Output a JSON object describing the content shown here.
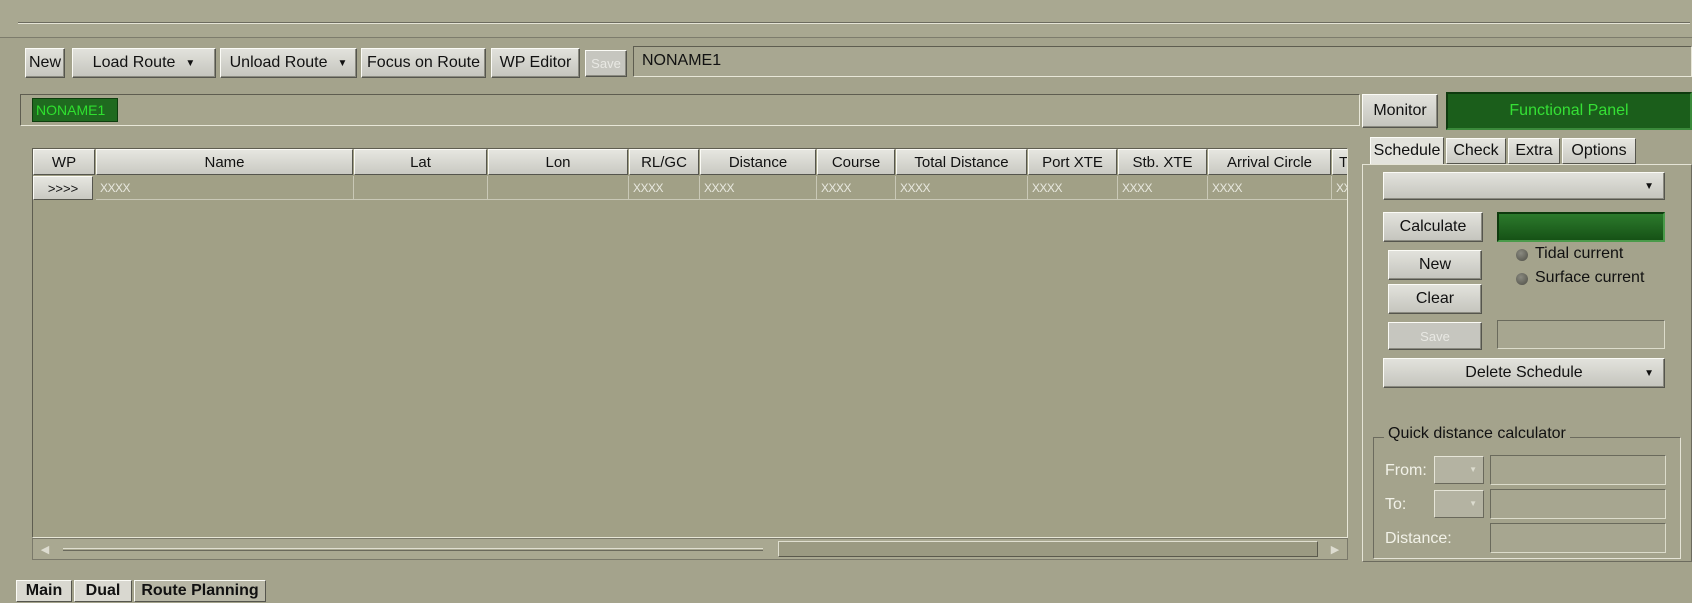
{
  "toolbar": {
    "new_label": "New",
    "load_route_label": "Load Route",
    "unload_route_label": "Unload Route",
    "focus_label": "Focus on Route",
    "wp_editor_label": "WP Editor",
    "save_label": "Save",
    "route_name": "NONAME1"
  },
  "route_tag": "NONAME1",
  "monitor_label": "Monitor",
  "functional_panel_label": "Functional Panel",
  "table": {
    "columns": [
      "WP",
      "Name",
      "Lat",
      "Lon",
      "RL/GC",
      "Distance",
      "Course",
      "Total Distance",
      "Port XTE",
      "Stb. XTE",
      "Arrival Circle",
      "T"
    ],
    "row": {
      "wp": ">>>>",
      "name": "XXXX",
      "lat": "",
      "lon": "",
      "rlgc": "XXXX",
      "distance": "XXXX",
      "course": "XXXX",
      "total_distance": "XXXX",
      "port_xte": "XXXX",
      "stb_xte": "XXXX",
      "arrival_circle": "XXXX",
      "t": "XX"
    }
  },
  "right_panel": {
    "tabs": [
      "Schedule",
      "Check",
      "Extra",
      "Options"
    ],
    "active_tab": "Schedule",
    "calculate_label": "Calculate",
    "new_label": "New",
    "clear_label": "Clear",
    "save_label": "Save",
    "tidal_current_label": "Tidal current",
    "surface_current_label": "Surface current",
    "delete_schedule_label": "Delete Schedule",
    "quick_calc": {
      "title": "Quick distance calculator",
      "from_label": "From:",
      "to_label": "To:",
      "distance_label": "Distance:"
    }
  },
  "bottom_tabs": [
    "Main",
    "Dual",
    "Route Planning"
  ],
  "colors": {
    "background": "#a4a38c",
    "indicator_green": "#1f6a1f",
    "text_green": "#2fe02f"
  }
}
